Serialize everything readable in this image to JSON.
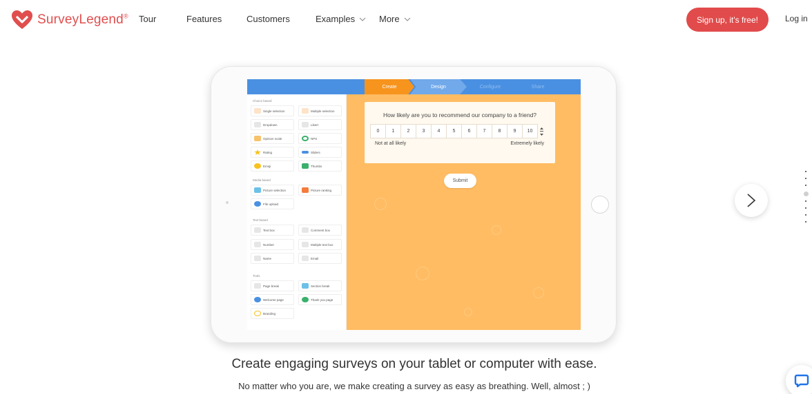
{
  "brand": {
    "name": "SurveyLegend",
    "mark": "®",
    "color": "#e04e4e"
  },
  "nav": {
    "links": [
      {
        "label": "Tour"
      },
      {
        "label": "Features"
      },
      {
        "label": "Customers"
      },
      {
        "label": "Examples",
        "has_dropdown": true
      },
      {
        "label": "More",
        "has_dropdown": true
      }
    ],
    "signup_label": "Sign up, it's free!",
    "login_label": "Log in"
  },
  "editor": {
    "steps": [
      "Create",
      "Design",
      "Configure",
      "Share"
    ],
    "active_step": "Create",
    "panel": {
      "sections": [
        {
          "title": "Choice based",
          "items": [
            "Single selection",
            "Multiple selection",
            "Dropdown",
            "Likert",
            "Opinion scale",
            "NPS",
            "Rating",
            "Sliders",
            "Emoji",
            "Thumbs"
          ]
        },
        {
          "title": "Media based",
          "items": [
            "Picture selection",
            "Picture ranking",
            "File upload"
          ]
        },
        {
          "title": "Text based",
          "items": [
            "Text box",
            "Comment box",
            "Number",
            "Multiple text box",
            "Name",
            "Email"
          ]
        },
        {
          "title": "Tools",
          "items": [
            "Page break",
            "Section break",
            "Welcome page",
            "Thank you page",
            "Branding"
          ]
        }
      ]
    },
    "question": {
      "title": "How likely are you to recommend our company to a friend?",
      "scale": [
        "0",
        "1",
        "2",
        "3",
        "4",
        "5",
        "6",
        "7",
        "8",
        "9",
        "10"
      ],
      "label_low": "Not at all likely",
      "label_high": "Extremely likely"
    },
    "submit_label": "Submit"
  },
  "carousel": {
    "slide_count": 8,
    "active_index": 3
  },
  "hero": {
    "headline": "Create engaging surveys on your tablet or computer with ease.",
    "subline": "No matter who you are, we make creating a survey as easy as breathing. Well, almost ; )"
  },
  "colors": {
    "accent": "#e14b4b",
    "editor_bar": "#4a90e2",
    "step_active": "#f7941d",
    "canvas": "#ffbc62"
  },
  "icons": {
    "next": "chevron-right-icon",
    "chat": "chat-icon"
  }
}
